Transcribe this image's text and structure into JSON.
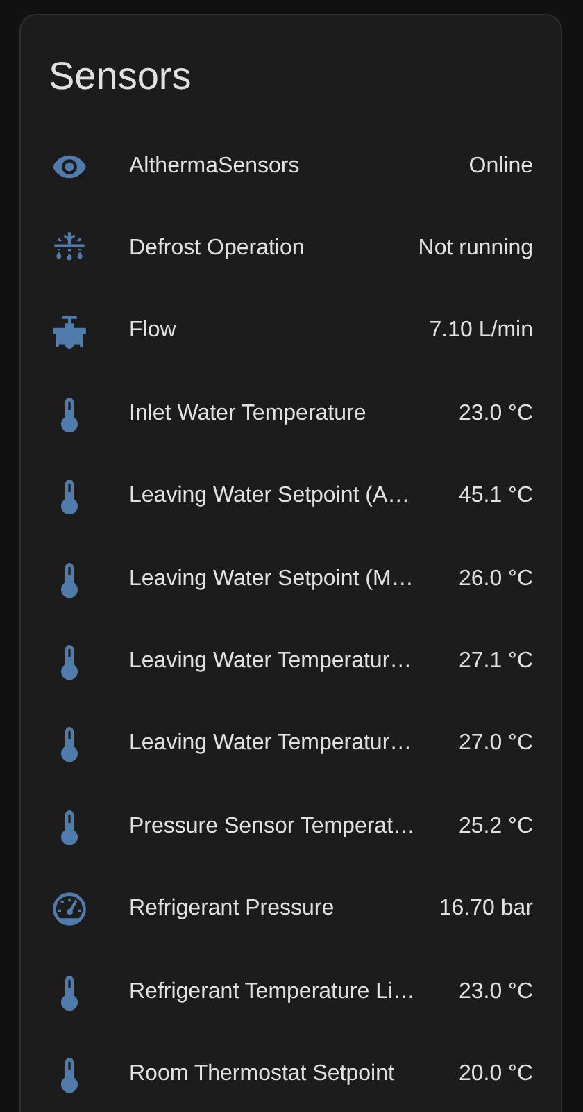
{
  "card": {
    "title": "Sensors"
  },
  "rows": [
    {
      "kind": "status",
      "name": "AlthermaSensors",
      "value": "Online"
    },
    {
      "kind": "defrost",
      "name": "Defrost Operation",
      "value": "Not running"
    },
    {
      "kind": "flow",
      "name": "Flow",
      "value": "7.10 L/min"
    },
    {
      "kind": "temperature",
      "name": "Inlet Water Temperature",
      "value": "23.0 °C"
    },
    {
      "kind": "temperature",
      "name": "Leaving Water Setpoint (A…",
      "value": "45.1 °C"
    },
    {
      "kind": "temperature",
      "name": "Leaving Water Setpoint (M…",
      "value": "26.0 °C"
    },
    {
      "kind": "temperature",
      "name": "Leaving Water Temperatur…",
      "value": "27.1 °C"
    },
    {
      "kind": "temperature",
      "name": "Leaving Water Temperatur…",
      "value": "27.0 °C"
    },
    {
      "kind": "temperature",
      "name": "Pressure Sensor Temperat…",
      "value": "25.2 °C"
    },
    {
      "kind": "pressure",
      "name": "Refrigerant Pressure",
      "value": "16.70 bar"
    },
    {
      "kind": "temperature",
      "name": "Refrigerant Temperature Li…",
      "value": "23.0 °C"
    },
    {
      "kind": "temperature",
      "name": "Room Thermostat Setpoint",
      "value": "20.0 °C"
    }
  ]
}
